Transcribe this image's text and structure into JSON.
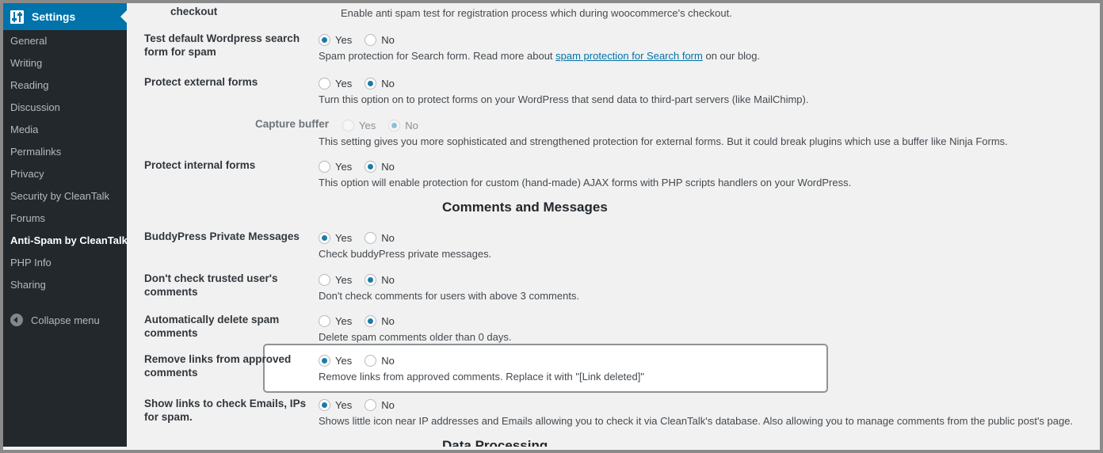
{
  "sidebar": {
    "header": {
      "label": "Settings",
      "icon": "settings-sliders-icon"
    },
    "items": [
      {
        "label": "General",
        "current": false
      },
      {
        "label": "Writing",
        "current": false
      },
      {
        "label": "Reading",
        "current": false
      },
      {
        "label": "Discussion",
        "current": false
      },
      {
        "label": "Media",
        "current": false
      },
      {
        "label": "Permalinks",
        "current": false
      },
      {
        "label": "Privacy",
        "current": false
      },
      {
        "label": "Security by CleanTalk",
        "current": false
      },
      {
        "label": "Forums",
        "current": false
      },
      {
        "label": "Anti-Spam by CleanTalk",
        "current": true
      },
      {
        "label": "PHP Info",
        "current": false
      },
      {
        "label": "Sharing",
        "current": false
      }
    ],
    "collapse": {
      "label": "Collapse menu",
      "icon": "collapse-arrow-icon"
    }
  },
  "options": {
    "yes": "Yes",
    "no": "No"
  },
  "rows": {
    "checkout": {
      "label": "checkout",
      "desc": "Enable anti spam test for registration process which during woocommerce's checkout."
    },
    "search_form": {
      "label": "Test default Wordpress search form for spam",
      "desc_before": "Spam protection for Search form. Read more about ",
      "link": "spam protection for Search form",
      "desc_after": " on our blog.",
      "selected": "Yes"
    },
    "external_forms": {
      "label": "Protect external forms",
      "desc": "Turn this option on to protect forms on your WordPress that send data to third-part servers (like MailChimp).",
      "selected": "No"
    },
    "capture_buffer": {
      "label": "Capture buffer",
      "desc": "This setting gives you more sophisticated and strengthened protection for external forms. But it could break plugins which use a buffer like Ninja Forms.",
      "selected": "No",
      "disabled": true
    },
    "internal_forms": {
      "label": "Protect internal forms",
      "desc": "This option will enable protection for custom (hand-made) AJAX forms with PHP scripts handlers on your WordPress.",
      "selected": "No"
    },
    "buddypress": {
      "label": "BuddyPress Private Messages",
      "desc": "Check buddyPress private messages.",
      "selected": "Yes"
    },
    "trusted_users": {
      "label": "Don't check trusted user's comments",
      "desc": "Don't check comments for users with above 3 comments.",
      "selected": "No"
    },
    "auto_delete": {
      "label": "Automatically delete spam comments",
      "desc": "Delete spam comments older than 0 days.",
      "selected": "No"
    },
    "remove_links": {
      "label": "Remove links from approved comments",
      "desc": "Remove links from approved comments. Replace it with \"[Link deleted]\"",
      "selected": "Yes",
      "highlighted": true
    },
    "show_links": {
      "label": "Show links to check Emails, IPs for spam.",
      "desc": "Shows little icon near IP addresses and Emails allowing you to check it via CleanTalk's database. Also allowing you to manage comments from the public post's page.",
      "selected": "Yes"
    }
  },
  "sections": {
    "comments_messages": "Comments and Messages",
    "data_processing": "Data Processing"
  },
  "colors": {
    "accent": "#0073aa",
    "radio_fill": "#1e7ba6",
    "sidebar_bg": "#23282d",
    "content_bg": "#f1f1f1",
    "highlight_border": "#8f9396"
  }
}
